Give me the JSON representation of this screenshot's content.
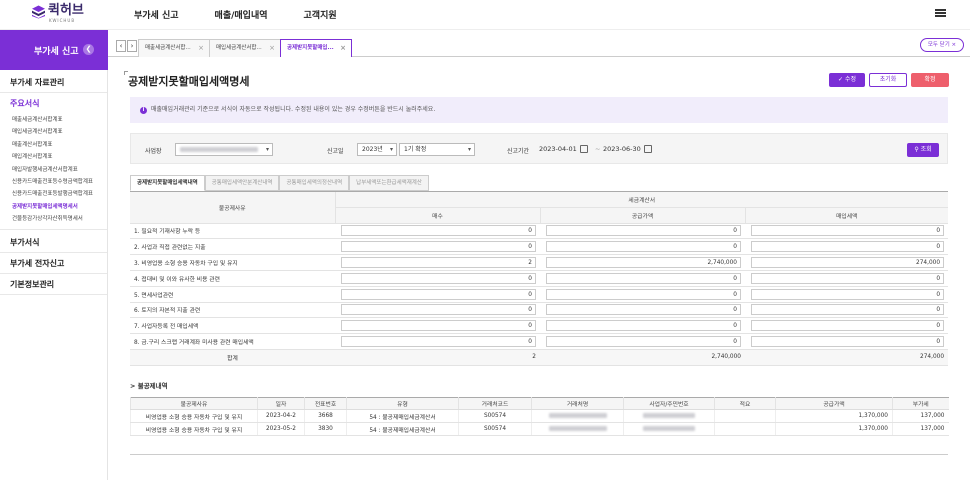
{
  "app": {
    "logo_text": "퀵허브",
    "logo_sub": "KWICHUB"
  },
  "topnav": [
    "부가세 신고",
    "매출/매입내역",
    "고객지원"
  ],
  "sidebar": {
    "header": "부가세 신고",
    "sections": [
      "부가세 자료관리",
      "부가서식",
      "부가세 전자신고",
      "기본정보관리"
    ],
    "main_label": "주요서식",
    "items": [
      "매출세금계산서합계표",
      "매입세금계산서합계표",
      "매출계산서합계표",
      "매입계산서합계표",
      "매입자발행세금계산서합계표",
      "신용카드매출전표등수령금액합계표",
      "신용카드매출전표등발행금액합계표",
      "공제받지못할매입세액명세서",
      "건물등감가상각자산취득명세서"
    ]
  },
  "tabs": {
    "items": [
      "매출세금계산서합...",
      "매입세금계산서합...",
      "공제받지못할매입..."
    ],
    "close_all": "모두 닫기 ×"
  },
  "page": {
    "title": "공제받지못할매입세액명세",
    "save": "수정",
    "reset": "초기화",
    "confirm": "확정",
    "notice": "매출매입거래관리 기준으로 서식이 자동으로 작성됩니다. 수정된 내용이 있는 경우 수정버튼을 반드시 눌러주세요."
  },
  "filter": {
    "business_label": "사업장",
    "period_label": "신고일",
    "year": "2023년",
    "term": "1기 확정",
    "range_label": "신고기간",
    "date_from": "2023-04-01",
    "date_to": "2023-06-30",
    "search": "조회"
  },
  "content_tabs": [
    "공제받지못할매입세액내역",
    "공통매입세액안분계산내역",
    "공통매입세액의정산내역",
    "납부세액또는환급세액재계산"
  ],
  "main_table": {
    "col_reason": "불공제사유",
    "col_group": "세금계산서",
    "col_count": "매수",
    "col_supply": "공급가액",
    "col_tax": "매입세액",
    "rows": [
      {
        "label": "1. 필요적 기재사항 누락 등",
        "count": "0",
        "supply": "0",
        "tax": "0"
      },
      {
        "label": "2. 사업과 직접 관련없는 지출",
        "count": "0",
        "supply": "0",
        "tax": "0"
      },
      {
        "label": "3. 비영업용 소형 승용 자동차 구입 및 유지",
        "count": "2",
        "supply": "2,740,000",
        "tax": "274,000"
      },
      {
        "label": "4. 접대비 및 이와 유사한 비용 관련",
        "count": "0",
        "supply": "0",
        "tax": "0"
      },
      {
        "label": "5. 면세사업관련",
        "count": "0",
        "supply": "0",
        "tax": "0"
      },
      {
        "label": "6. 토지의 자본적 지출 관련",
        "count": "0",
        "supply": "0",
        "tax": "0"
      },
      {
        "label": "7. 사업자등록 전 매입세액",
        "count": "0",
        "supply": "0",
        "tax": "0"
      },
      {
        "label": "8. 금.구리 스크랩 거래계좌 미사용 관련 매입세액",
        "count": "0",
        "supply": "0",
        "tax": "0"
      }
    ],
    "total": {
      "label": "합계",
      "count": "2",
      "supply": "2,740,000",
      "tax": "274,000"
    }
  },
  "detail": {
    "title": "> 불공제내역",
    "headers": [
      "불공제사유",
      "일자",
      "전표번호",
      "유형",
      "거래처코드",
      "거래처명",
      "사업자/주민번호",
      "적요",
      "공급가액",
      "부가세"
    ],
    "rows": [
      {
        "reason": "비영업용 소형 승용 자동차 구입 및 유지",
        "date": "2023-04-2",
        "slip": "3668",
        "type": "54 : 불공제매입세금계산서",
        "code": "S00574",
        "supply": "1,370,000",
        "vat": "137,000"
      },
      {
        "reason": "비영업용 소형 승용 자동차 구입 및 유지",
        "date": "2023-05-2",
        "slip": "3830",
        "type": "54 : 불공제매입세금계산서",
        "code": "S00574",
        "supply": "1,370,000",
        "vat": "137,000"
      }
    ]
  },
  "colors": {
    "accent": "#7b2fd6",
    "danger": "#ee5f6c",
    "notice_bg": "#f1edfb"
  }
}
